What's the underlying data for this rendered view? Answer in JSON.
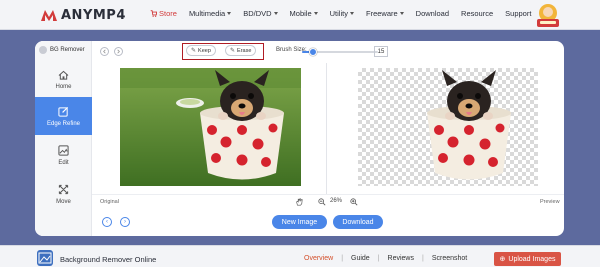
{
  "brand": {
    "name": "ANYMP4"
  },
  "topnav": {
    "items": [
      {
        "label": "Store",
        "dropdown": false
      },
      {
        "label": "Multimedia",
        "dropdown": true
      },
      {
        "label": "BD/DVD",
        "dropdown": true
      },
      {
        "label": "Mobile",
        "dropdown": true
      },
      {
        "label": "Utility",
        "dropdown": true
      },
      {
        "label": "Freeware",
        "dropdown": true
      },
      {
        "label": "Download",
        "dropdown": false
      },
      {
        "label": "Resource",
        "dropdown": false
      },
      {
        "label": "Support",
        "dropdown": false
      }
    ]
  },
  "sidebar": {
    "title": "BG Remover",
    "items": [
      {
        "label": "Home",
        "icon": "home-icon"
      },
      {
        "label": "Edge Refine",
        "icon": "edit-square-icon",
        "active": true
      },
      {
        "label": "Edit",
        "icon": "image-edit-icon"
      },
      {
        "label": "Move",
        "icon": "move-arrows-icon"
      }
    ]
  },
  "toolbar": {
    "keep_label": "Keep",
    "erase_label": "Erase",
    "brush_size_label": "Brush Size:",
    "brush_size_value": "15",
    "brush_slider_fraction": 0.15
  },
  "canvas": {
    "original_label": "Original",
    "preview_label": "Preview",
    "zoom_value": "26%"
  },
  "actions": {
    "new_image_label": "New Image",
    "download_label": "Download"
  },
  "footer": {
    "title": "Background Remover Online",
    "links": [
      "Overview",
      "Guide",
      "Reviews",
      "Screenshot"
    ],
    "active_link": "Overview",
    "upload_label": "Upload Images"
  },
  "colors": {
    "accent": "#4a86e8",
    "brand_red": "#d23b3b",
    "highlight_box": "#b01c24",
    "upload_button": "#d95445",
    "page_background": "#5d6a9e"
  }
}
